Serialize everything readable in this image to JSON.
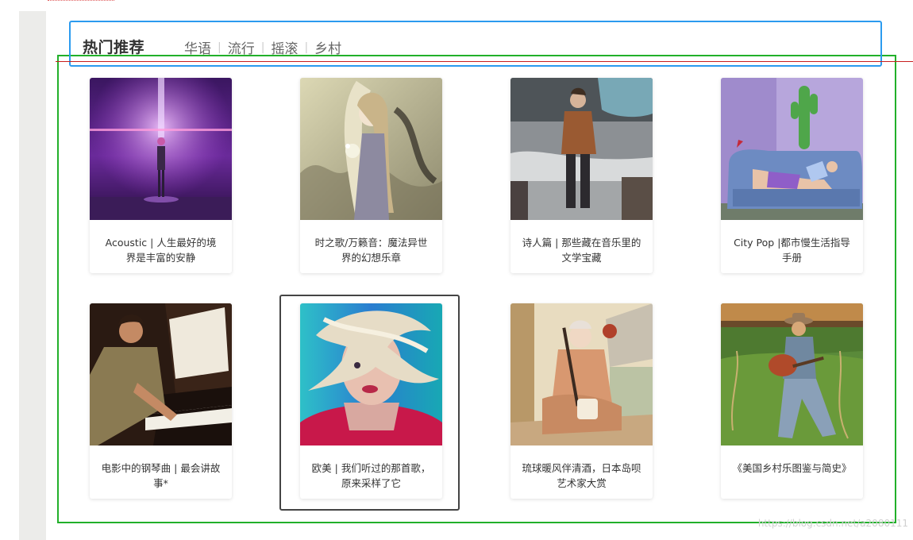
{
  "header": {
    "title": "热门推荐",
    "tabs": [
      {
        "label": "华语"
      },
      {
        "label": "流行"
      },
      {
        "label": "摇滚"
      },
      {
        "label": "乡村"
      }
    ],
    "separator": "|"
  },
  "playlists": [
    {
      "title": "Acoustic | 人生最好的境界是丰富的安静",
      "cover": "purple-concert-stage-image"
    },
    {
      "title": "时之歌/万籁音：魔法异世界的幻想乐章",
      "cover": "fantasy-elf-girl-illustration"
    },
    {
      "title": "诗人篇 | 那些藏在音乐里的文学宝藏",
      "cover": "street-folk-singer-photo"
    },
    {
      "title": "City Pop |都市慢生活指导手册",
      "cover": "girl-reading-on-sofa-illustration"
    },
    {
      "title": "电影中的钢琴曲 | 最会讲故事*",
      "cover": "pianist-at-piano-photo"
    },
    {
      "title": "欧美 | 我们听过的那首歌，原来采样了它",
      "cover": "wind-blown-hair-portrait"
    },
    {
      "title": "琉球暖风伴清酒，日本岛呗艺术家大赏",
      "cover": "shamisen-player-illustration"
    },
    {
      "title": "《美国乡村乐图鉴与简史》",
      "cover": "country-guitarist-in-field-photo"
    }
  ],
  "watermark": "https://blog.csdn.net/a2080111",
  "colors": {
    "annotation_blue": "#2b9bef",
    "annotation_green": "#22b02a",
    "annotation_red": "#c81e1e",
    "focus_border": "#444444"
  }
}
